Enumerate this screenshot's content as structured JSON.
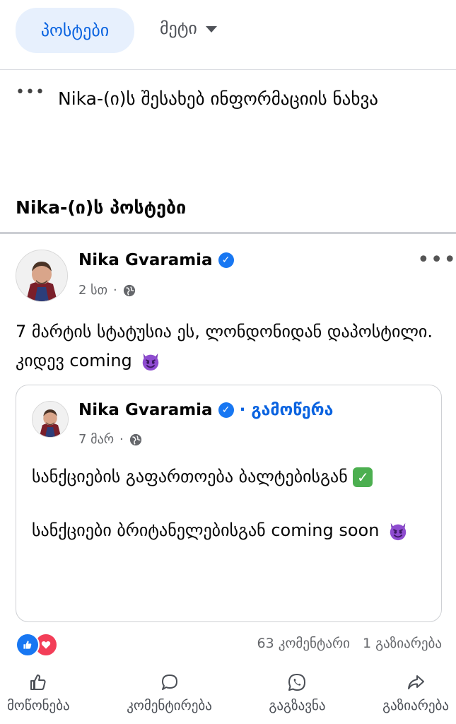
{
  "tabs": {
    "active": "პოსტები",
    "more": "მეტი"
  },
  "info": {
    "dots": "•••",
    "text": "Nika-(ი)ს შესახებ ინფორმაციის ნახვა"
  },
  "section": {
    "title": "Nika-(ი)ს პოსტები"
  },
  "post": {
    "author": "Nika Gvaramia",
    "time": "2 სთ",
    "more": "•••",
    "text": "7 მარტის სტატუსია ეს, ლონდონიდან დაპოსტილი. კიდევ coming"
  },
  "shared": {
    "author": "Nika Gvaramia",
    "follow": "გამოწერა",
    "separator": "·",
    "time": "7 მარ",
    "line1": "სანქციების გაფართოება ბალტებისგან",
    "line2": "სანქციები ბრიტანელებისგან coming soon"
  },
  "stats": {
    "comments": "63 კომენტარი",
    "shares": "1 გაზიარება"
  },
  "actions": {
    "like": "მოწონება",
    "comment": "კომენტირება",
    "send": "გაგზავნა",
    "share": "გაზიარება"
  },
  "colors": {
    "accent": "#0a63e0",
    "verified": "#1877f2",
    "like": "#1877f2",
    "love": "#f33e58"
  },
  "icons": [
    "chevron-down-icon",
    "more-icon",
    "verified-icon",
    "globe-icon",
    "devil-emoji",
    "check-emoji",
    "like-icon",
    "comment-icon",
    "whatsapp-icon",
    "share-icon"
  ]
}
